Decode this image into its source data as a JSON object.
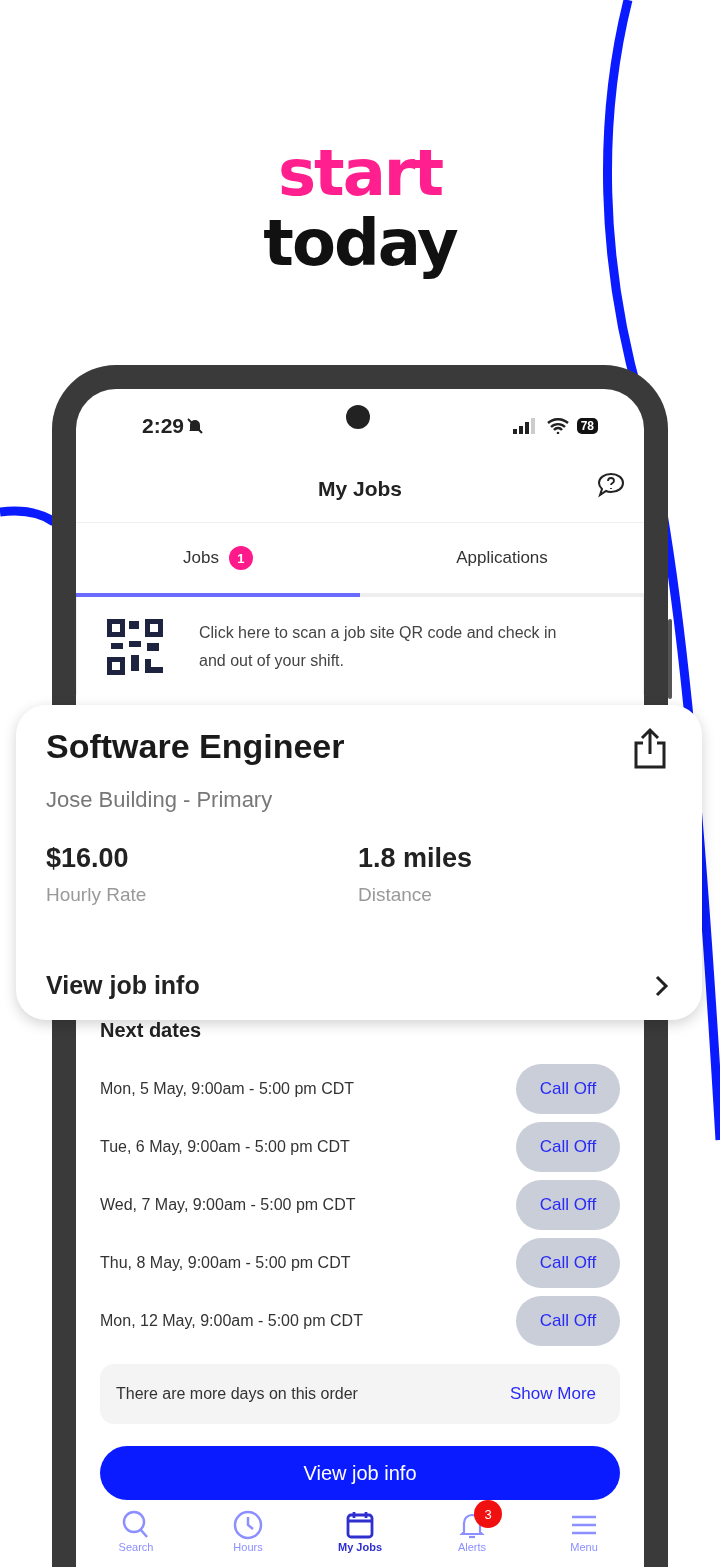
{
  "headline": {
    "line_1": "start",
    "line_2": "today"
  },
  "status_bar": {
    "time": "2:29",
    "battery": "78"
  },
  "header": {
    "title": "My Jobs"
  },
  "tabs": [
    {
      "label": "Jobs",
      "badge": "1",
      "selected": true
    },
    {
      "label": "Applications",
      "selected": false
    }
  ],
  "qr_banner": {
    "text": "Click here to scan a job site QR code and check in and out of your shift."
  },
  "job_card": {
    "title": "Software Engineer",
    "location": "Jose Building - Primary",
    "stats": [
      {
        "value": "$16.00",
        "label": "Hourly Rate"
      },
      {
        "value": "1.8 miles",
        "label": "Distance"
      }
    ],
    "link": "View job info"
  },
  "next_dates": {
    "title": "Next dates",
    "rows": [
      {
        "date": "Mon, 5 May, 9:00am - 5:00 pm CDT",
        "action": "Call Off"
      },
      {
        "date": "Tue, 6 May, 9:00am - 5:00 pm CDT",
        "action": "Call Off"
      },
      {
        "date": "Wed, 7 May, 9:00am - 5:00 pm CDT",
        "action": "Call Off"
      },
      {
        "date": "Thu, 8 May, 9:00am - 5:00 pm CDT",
        "action": "Call Off"
      },
      {
        "date": "Mon, 12 May, 9:00am - 5:00 pm CDT",
        "action": "Call Off"
      }
    ]
  },
  "more_days": {
    "text": "There are more days on this order",
    "link": "Show More"
  },
  "primary_button": "View job info",
  "bottom_nav": [
    {
      "kind": "search",
      "label": "Search",
      "selected": false
    },
    {
      "kind": "hours",
      "label": "Hours",
      "selected": false
    },
    {
      "kind": "calendar",
      "label": "My Jobs",
      "selected": true
    },
    {
      "kind": "alerts",
      "label": "Alerts",
      "badge": "3",
      "selected": false
    },
    {
      "kind": "menu",
      "label": "Menu",
      "selected": false
    }
  ]
}
